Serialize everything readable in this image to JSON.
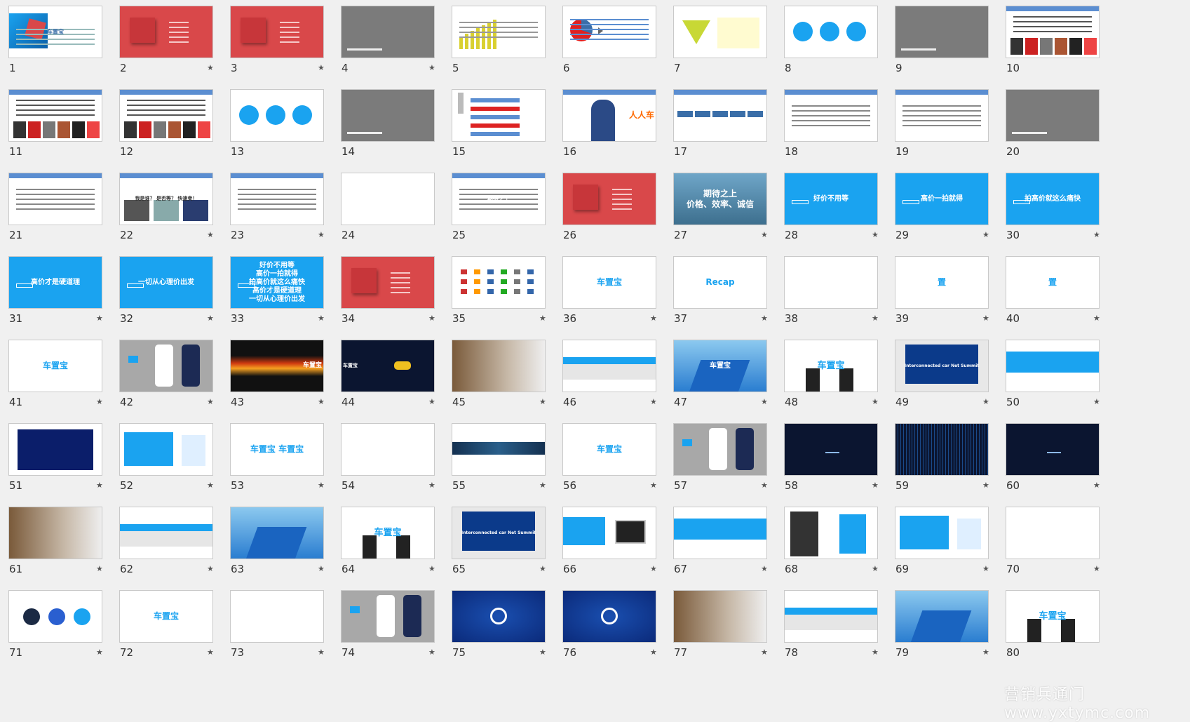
{
  "slides": [
    {
      "number": "1",
      "starred": false,
      "style": "cover",
      "text": "车置宝"
    },
    {
      "number": "2",
      "starred": true,
      "style": "red",
      "text": ""
    },
    {
      "number": "3",
      "starred": true,
      "style": "red",
      "text": ""
    },
    {
      "number": "4",
      "starred": true,
      "style": "gray",
      "text": ""
    },
    {
      "number": "5",
      "starred": false,
      "style": "chart",
      "text": ""
    },
    {
      "number": "6",
      "starred": false,
      "style": "pie",
      "text": ""
    },
    {
      "number": "7",
      "starred": false,
      "style": "triangle",
      "text": ""
    },
    {
      "number": "8",
      "starred": false,
      "style": "circles",
      "text": ""
    },
    {
      "number": "9",
      "starred": false,
      "style": "gray",
      "text": ""
    },
    {
      "number": "10",
      "starred": false,
      "style": "collage",
      "text": ""
    },
    {
      "number": "11",
      "starred": false,
      "style": "collage",
      "text": ""
    },
    {
      "number": "12",
      "starred": false,
      "style": "collage",
      "text": ""
    },
    {
      "number": "13",
      "starred": false,
      "style": "circles",
      "text": ""
    },
    {
      "number": "14",
      "starred": false,
      "style": "gray",
      "text": ""
    },
    {
      "number": "15",
      "starred": false,
      "style": "redlist",
      "text": ""
    },
    {
      "number": "16",
      "starred": false,
      "style": "photo-person",
      "text": "人人车"
    },
    {
      "number": "17",
      "starred": false,
      "style": "flow",
      "text": ""
    },
    {
      "number": "18",
      "starred": false,
      "style": "header",
      "text": ""
    },
    {
      "number": "19",
      "starred": false,
      "style": "header",
      "text": ""
    },
    {
      "number": "20",
      "starred": false,
      "style": "gray",
      "text": ""
    },
    {
      "number": "21",
      "starred": false,
      "style": "header",
      "text": ""
    },
    {
      "number": "22",
      "starred": true,
      "style": "header-photos",
      "text": "我是谁？ 是否等？ 快速卖！"
    },
    {
      "number": "23",
      "starred": true,
      "style": "header",
      "text": ""
    },
    {
      "number": "24",
      "starred": false,
      "style": "white",
      "text": ""
    },
    {
      "number": "25",
      "starred": false,
      "style": "header",
      "text": "“期待之上”"
    },
    {
      "number": "26",
      "starred": false,
      "style": "red",
      "text": ""
    },
    {
      "number": "27",
      "starred": true,
      "style": "photo-cars",
      "text": "期待之上\n价格、效率、诚信"
    },
    {
      "number": "28",
      "starred": true,
      "style": "blue",
      "text": "好价不用等"
    },
    {
      "number": "29",
      "starred": true,
      "style": "blue",
      "text": "高价一拍就得"
    },
    {
      "number": "30",
      "starred": true,
      "style": "blue",
      "text": "拍高价就这么痛快"
    },
    {
      "number": "31",
      "starred": true,
      "style": "blue",
      "text": "高价才是硬道理"
    },
    {
      "number": "32",
      "starred": true,
      "style": "blue",
      "text": "一切从心理价出发"
    },
    {
      "number": "33",
      "starred": true,
      "style": "blue",
      "text": "好价不用等\n高价一拍就得\n拍高价就这么痛快\n高价才是硬道理\n一切从心理价出发"
    },
    {
      "number": "34",
      "starred": true,
      "style": "red",
      "text": ""
    },
    {
      "number": "35",
      "starred": true,
      "style": "logos",
      "text": ""
    },
    {
      "number": "36",
      "starred": true,
      "style": "white-logo",
      "text": "车置宝"
    },
    {
      "number": "37",
      "starred": true,
      "style": "white",
      "text": "Recap"
    },
    {
      "number": "38",
      "starred": true,
      "style": "white",
      "text": ""
    },
    {
      "number": "39",
      "starred": true,
      "style": "white-logo",
      "text": "置"
    },
    {
      "number": "40",
      "starred": true,
      "style": "white-logo",
      "text": "置"
    },
    {
      "number": "41",
      "starred": true,
      "style": "white-logo",
      "text": "车置宝"
    },
    {
      "number": "42",
      "starred": true,
      "style": "phones",
      "text": ""
    },
    {
      "number": "43",
      "starred": true,
      "style": "dark-lights",
      "text": "车置宝"
    },
    {
      "number": "44",
      "starred": true,
      "style": "dark-car",
      "text": "车置宝"
    },
    {
      "number": "45",
      "starred": true,
      "style": "office",
      "text": ""
    },
    {
      "number": "46",
      "starred": true,
      "style": "storefront",
      "text": ""
    },
    {
      "number": "47",
      "starred": true,
      "style": "building",
      "text": "车置宝"
    },
    {
      "number": "48",
      "starred": true,
      "style": "handshake",
      "text": "车置宝"
    },
    {
      "number": "49",
      "starred": true,
      "style": "stage",
      "text": "Interconnected car Net Summit"
    },
    {
      "number": "50",
      "starred": true,
      "style": "blue-bar",
      "text": ""
    },
    {
      "number": "51",
      "starred": true,
      "style": "car-interior",
      "text": ""
    },
    {
      "number": "52",
      "starred": true,
      "style": "badge",
      "text": ""
    },
    {
      "number": "53",
      "starred": true,
      "style": "white-logo",
      "text": "车置宝 车置宝"
    },
    {
      "number": "54",
      "starred": true,
      "style": "white",
      "text": ""
    },
    {
      "number": "55",
      "starred": true,
      "style": "strip",
      "text": ""
    },
    {
      "number": "56",
      "starred": true,
      "style": "white-logo",
      "text": "车置宝"
    },
    {
      "number": "57",
      "starred": true,
      "style": "phones",
      "text": ""
    },
    {
      "number": "58",
      "starred": true,
      "style": "dark",
      "text": ""
    },
    {
      "number": "59",
      "starred": true,
      "style": "dark-matrix",
      "text": ""
    },
    {
      "number": "60",
      "starred": true,
      "style": "dark",
      "text": ""
    },
    {
      "number": "61",
      "starred": true,
      "style": "office",
      "text": ""
    },
    {
      "number": "62",
      "starred": true,
      "style": "storefront",
      "text": ""
    },
    {
      "number": "63",
      "starred": true,
      "style": "building",
      "text": ""
    },
    {
      "number": "64",
      "starred": true,
      "style": "handshake",
      "text": "车置宝"
    },
    {
      "number": "65",
      "starred": true,
      "style": "stage",
      "text": "Interconnected car Net Summit"
    },
    {
      "number": "66",
      "starred": true,
      "style": "monitor",
      "text": ""
    },
    {
      "number": "67",
      "starred": true,
      "style": "blue-bar",
      "text": ""
    },
    {
      "number": "68",
      "starred": true,
      "style": "poster",
      "text": ""
    },
    {
      "number": "69",
      "starred": true,
      "style": "badge",
      "text": ""
    },
    {
      "number": "70",
      "starred": true,
      "style": "white",
      "text": ""
    },
    {
      "number": "71",
      "starred": true,
      "style": "dials",
      "text": ""
    },
    {
      "number": "72",
      "starred": true,
      "style": "white-logo",
      "text": "车置宝"
    },
    {
      "number": "73",
      "starred": true,
      "style": "white",
      "text": ""
    },
    {
      "number": "74",
      "starred": true,
      "style": "phones",
      "text": ""
    },
    {
      "number": "75",
      "starred": true,
      "style": "deep-blue",
      "text": ""
    },
    {
      "number": "76",
      "starred": true,
      "style": "deep-blue",
      "text": ""
    },
    {
      "number": "77",
      "starred": true,
      "style": "office",
      "text": ""
    },
    {
      "number": "78",
      "starred": true,
      "style": "storefront",
      "text": ""
    },
    {
      "number": "79",
      "starred": true,
      "style": "building",
      "text": ""
    },
    {
      "number": "80",
      "starred": false,
      "style": "handshake",
      "text": "车置宝"
    }
  ],
  "watermark": "营销兵通门 www.yxtymc.com",
  "star_glyph": "★",
  "colors": {
    "red": "#d9484a",
    "blue": "#1aa3f0",
    "gray": "#7b7b7b",
    "dark": "#0b1530",
    "header": "#5b8ed1"
  }
}
